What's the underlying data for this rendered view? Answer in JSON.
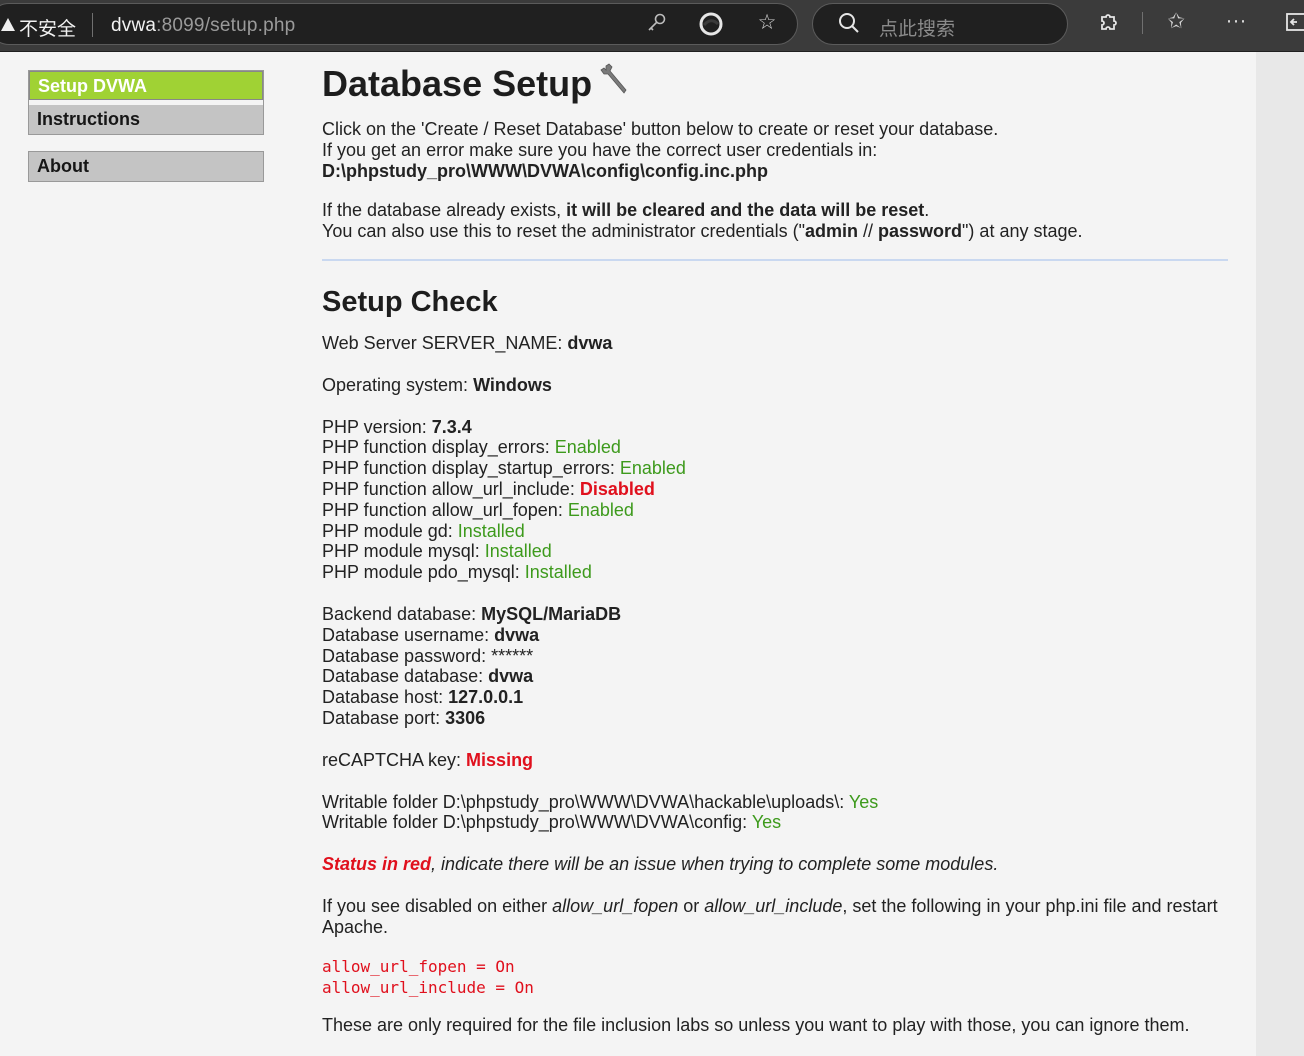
{
  "browser": {
    "insecure_label": "不安全",
    "url_host": "dvwa",
    "url_rest": ":8099/setup.php",
    "search_placeholder": "点此搜索"
  },
  "sidebar": {
    "items": [
      {
        "label": "Setup DVWA",
        "selected": true
      },
      {
        "label": "Instructions"
      },
      {
        "label": "About"
      }
    ]
  },
  "db_setup": {
    "title": "Database Setup",
    "intro_line1": "Click on the 'Create / Reset Database' button below to create or reset your database.",
    "intro_line2": "If you get an error make sure you have the correct user credentials in:",
    "config_path": "D:\\phpstudy_pro\\WWW\\DVWA\\config\\config.inc.php",
    "exists_pre": "If the database already exists, ",
    "exists_bold": "it will be cleared and the data will be reset",
    "exists_post": ".",
    "reset_pre": "You can also use this to reset the administrator credentials (\"",
    "reset_user": "admin",
    "reset_mid": " // ",
    "reset_pass": "password",
    "reset_post": "\") at any stage."
  },
  "setup_check": {
    "title": "Setup Check",
    "server_name_label": "Web Server SERVER_NAME: ",
    "server_name_value": "dvwa",
    "os_label": "Operating system: ",
    "os_value": "Windows",
    "php_version_label": "PHP version: ",
    "php_version_value": "7.3.4",
    "php_checks": [
      {
        "label": "PHP function display_errors: ",
        "value": "Enabled",
        "status": "ok"
      },
      {
        "label": "PHP function display_startup_errors: ",
        "value": "Enabled",
        "status": "ok"
      },
      {
        "label": "PHP function allow_url_include: ",
        "value": "Disabled",
        "status": "error"
      },
      {
        "label": "PHP function allow_url_fopen: ",
        "value": "Enabled",
        "status": "ok"
      },
      {
        "label": "PHP module gd: ",
        "value": "Installed",
        "status": "ok"
      },
      {
        "label": "PHP module mysql: ",
        "value": "Installed",
        "status": "ok"
      },
      {
        "label": "PHP module pdo_mysql: ",
        "value": "Installed",
        "status": "ok"
      }
    ],
    "db_info": [
      {
        "label": "Backend database: ",
        "value": "MySQL/MariaDB",
        "bold": true
      },
      {
        "label": "Database username: ",
        "value": "dvwa",
        "bold": true
      },
      {
        "label": "Database password: ",
        "value": "******",
        "bold": false
      },
      {
        "label": "Database database: ",
        "value": "dvwa",
        "bold": true
      },
      {
        "label": "Database host: ",
        "value": "127.0.0.1",
        "bold": true
      },
      {
        "label": "Database port: ",
        "value": "3306",
        "bold": true
      }
    ],
    "recaptcha_label": "reCAPTCHA key: ",
    "recaptcha_value": "Missing",
    "writable": [
      {
        "label": "Writable folder D:\\phpstudy_pro\\WWW\\DVWA\\hackable\\uploads\\: ",
        "value": "Yes"
      },
      {
        "label": "Writable folder D:\\phpstudy_pro\\WWW\\DVWA\\config: ",
        "value": "Yes"
      }
    ],
    "status_note_red": "Status in red",
    "status_note_rest": ", indicate there will be an issue when trying to complete some modules.",
    "disabled_pre": "If you see disabled on either ",
    "disabled_opt1": "allow_url_fopen",
    "disabled_mid": " or ",
    "disabled_opt2": "allow_url_include",
    "disabled_post": ", set the following in your php.ini file and restart Apache.",
    "ini_line1": "allow_url_fopen = On",
    "ini_line2": "allow_url_include = On",
    "footer_note": "These are only required for the file inclusion labs so unless you want to play with those, you can ignore them."
  },
  "colors": {
    "ok": "#3d9a1c",
    "error": "#e0101d",
    "menu_selected": "#a0d234"
  }
}
